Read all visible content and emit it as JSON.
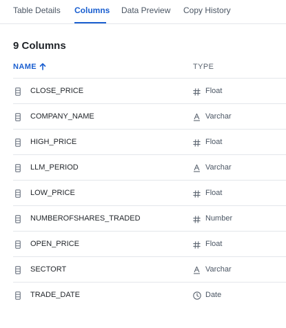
{
  "tabs": [
    {
      "label": "Table Details",
      "active": false
    },
    {
      "label": "Columns",
      "active": true
    },
    {
      "label": "Data Preview",
      "active": false
    },
    {
      "label": "Copy History",
      "active": false
    }
  ],
  "heading": "9 Columns",
  "headers": {
    "name": "NAME",
    "type": "TYPE",
    "sort": "ascending"
  },
  "rows": [
    {
      "name": "CLOSE_PRICE",
      "type": "Float",
      "type_icon": "hash-icon"
    },
    {
      "name": "COMPANY_NAME",
      "type": "Varchar",
      "type_icon": "text-icon"
    },
    {
      "name": "HIGH_PRICE",
      "type": "Float",
      "type_icon": "hash-icon"
    },
    {
      "name": "LLM_PERIOD",
      "type": "Varchar",
      "type_icon": "text-icon"
    },
    {
      "name": "LOW_PRICE",
      "type": "Float",
      "type_icon": "hash-icon"
    },
    {
      "name": "NUMBEROFSHARES_TRADED",
      "type": "Number",
      "type_icon": "hash-icon"
    },
    {
      "name": "OPEN_PRICE",
      "type": "Float",
      "type_icon": "hash-icon"
    },
    {
      "name": "SECTORT",
      "type": "Varchar",
      "type_icon": "text-icon"
    },
    {
      "name": "TRADE_DATE",
      "type": "Date",
      "type_icon": "clock-icon"
    }
  ],
  "colors": {
    "accent": "#1a5fd0",
    "text": "#1f2328",
    "muted": "#5b6470",
    "divider": "#e3e6ea"
  }
}
